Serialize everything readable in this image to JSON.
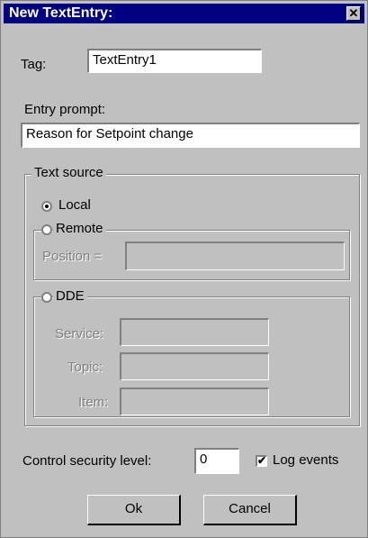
{
  "window": {
    "title": "New TextEntry:",
    "close_label": "✕"
  },
  "tag": {
    "label": "Tag:",
    "value": "TextEntry1"
  },
  "entry_prompt": {
    "label": "Entry prompt:",
    "value": "Reason for Setpoint change"
  },
  "text_source": {
    "title": "Text source",
    "local_label": "Local",
    "local_selected": true,
    "remote": {
      "label": "Remote",
      "selected": false,
      "position_label": "Position =",
      "position_value": ""
    },
    "dde": {
      "label": "DDE",
      "selected": false,
      "service_label": "Service:",
      "service_value": "",
      "topic_label": "Topic:",
      "topic_value": "",
      "item_label": "Item:",
      "item_value": ""
    }
  },
  "security": {
    "label": "Control security level:",
    "value": "0"
  },
  "log_events": {
    "label": "Log events",
    "checked": true
  },
  "buttons": {
    "ok_label": "Ok",
    "cancel_label": "Cancel"
  },
  "colors": {
    "titlebar": "#000080",
    "face": "#c0c0c0"
  }
}
